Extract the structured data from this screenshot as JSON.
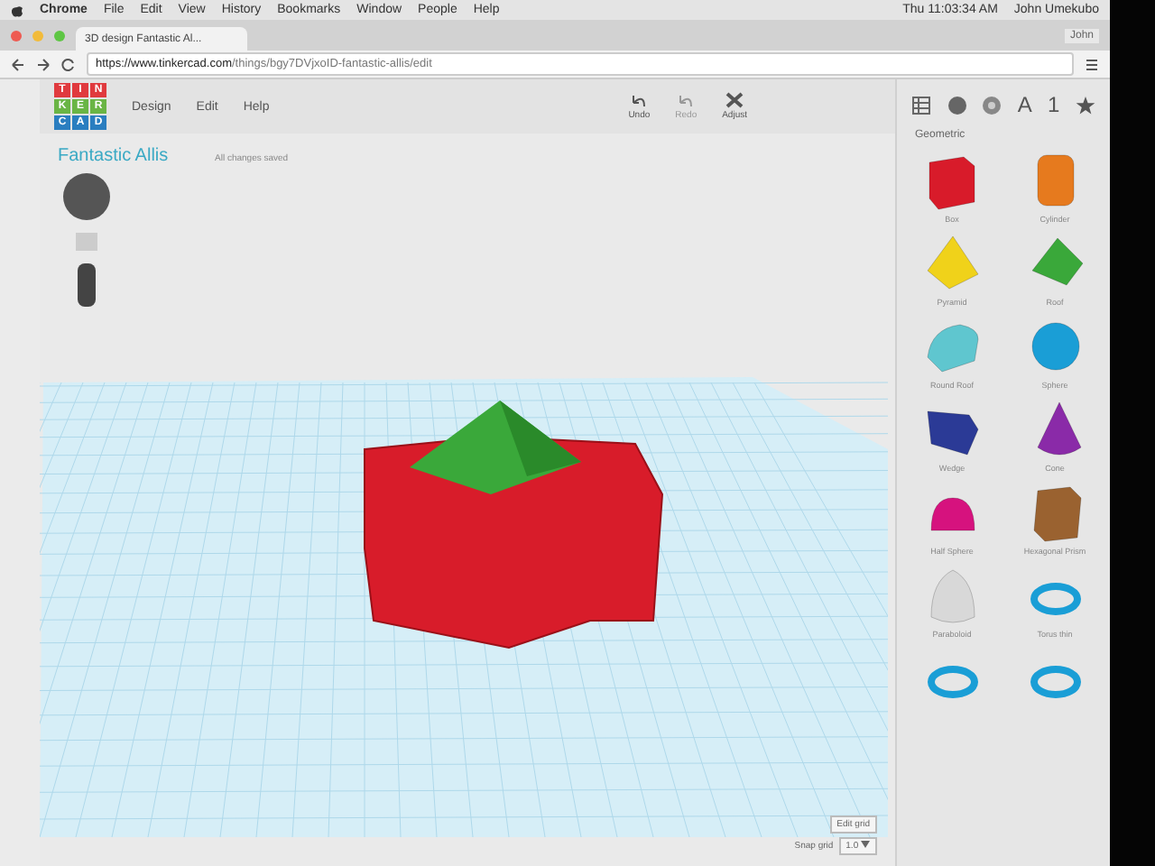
{
  "menubar": {
    "app": "Chrome",
    "items": [
      "File",
      "Edit",
      "View",
      "History",
      "Bookmarks",
      "Window",
      "People",
      "Help"
    ],
    "clock": "Thu 11:03:34 AM",
    "user": "John Umekubo"
  },
  "browser": {
    "tab_title": "3D design Fantastic Al...",
    "profile": "John",
    "url_host": "https://www.tinkercad.com",
    "url_path": "/things/bgy7DVjxoID-fantastic-allis/edit"
  },
  "app": {
    "logo": [
      "T",
      "I",
      "N",
      "K",
      "E",
      "R",
      "C",
      "A",
      "D"
    ],
    "menu": [
      "Design",
      "Edit",
      "Help"
    ],
    "tools": [
      {
        "label": "Undo",
        "disabled": false
      },
      {
        "label": "Redo",
        "disabled": true
      },
      {
        "label": "Adjust",
        "disabled": false
      }
    ]
  },
  "design": {
    "title": "Fantastic Allis",
    "status": "All changes saved"
  },
  "workplane": {
    "edit_grid": "Edit grid",
    "snap_label": "Snap grid",
    "snap_value": "1.0"
  },
  "panel": {
    "tabs": [
      {
        "kind": "grid",
        "selected": false
      },
      {
        "kind": "shape",
        "selected": false
      },
      {
        "kind": "logo",
        "selected": false
      },
      {
        "kind": "letter",
        "label": "A",
        "selected": false
      },
      {
        "kind": "number",
        "label": "1",
        "selected": false
      },
      {
        "kind": "star",
        "selected": false
      }
    ],
    "section": "Geometric",
    "shapes": [
      {
        "kind": "box",
        "label": "Box",
        "color": "#d81b2a"
      },
      {
        "kind": "cylinder",
        "label": "Cylinder",
        "color": "#e67a1e"
      },
      {
        "kind": "pyramid",
        "label": "Pyramid",
        "color": "#f0d21a"
      },
      {
        "kind": "roof",
        "label": "Roof",
        "color": "#3aa83a"
      },
      {
        "kind": "roundroof",
        "label": "Round Roof",
        "color": "#5fc6cf"
      },
      {
        "kind": "sphere",
        "label": "Sphere",
        "color": "#1a9ed6"
      },
      {
        "kind": "wedge",
        "label": "Wedge",
        "color": "#2b3a96"
      },
      {
        "kind": "cone",
        "label": "Cone",
        "color": "#8a2aa8"
      },
      {
        "kind": "halfsphere",
        "label": "Half Sphere",
        "color": "#d6127e"
      },
      {
        "kind": "prism",
        "label": "Hexagonal Prism",
        "color": "#9a6230"
      },
      {
        "kind": "paraboloid",
        "label": "Paraboloid",
        "color": "#d8d8d8"
      },
      {
        "kind": "torus",
        "label": "Torus thin",
        "color": "#1a9ed6"
      },
      {
        "kind": "torus",
        "color": "#1a9ed6"
      },
      {
        "kind": "torus",
        "color": "#1a9ed6"
      }
    ]
  }
}
